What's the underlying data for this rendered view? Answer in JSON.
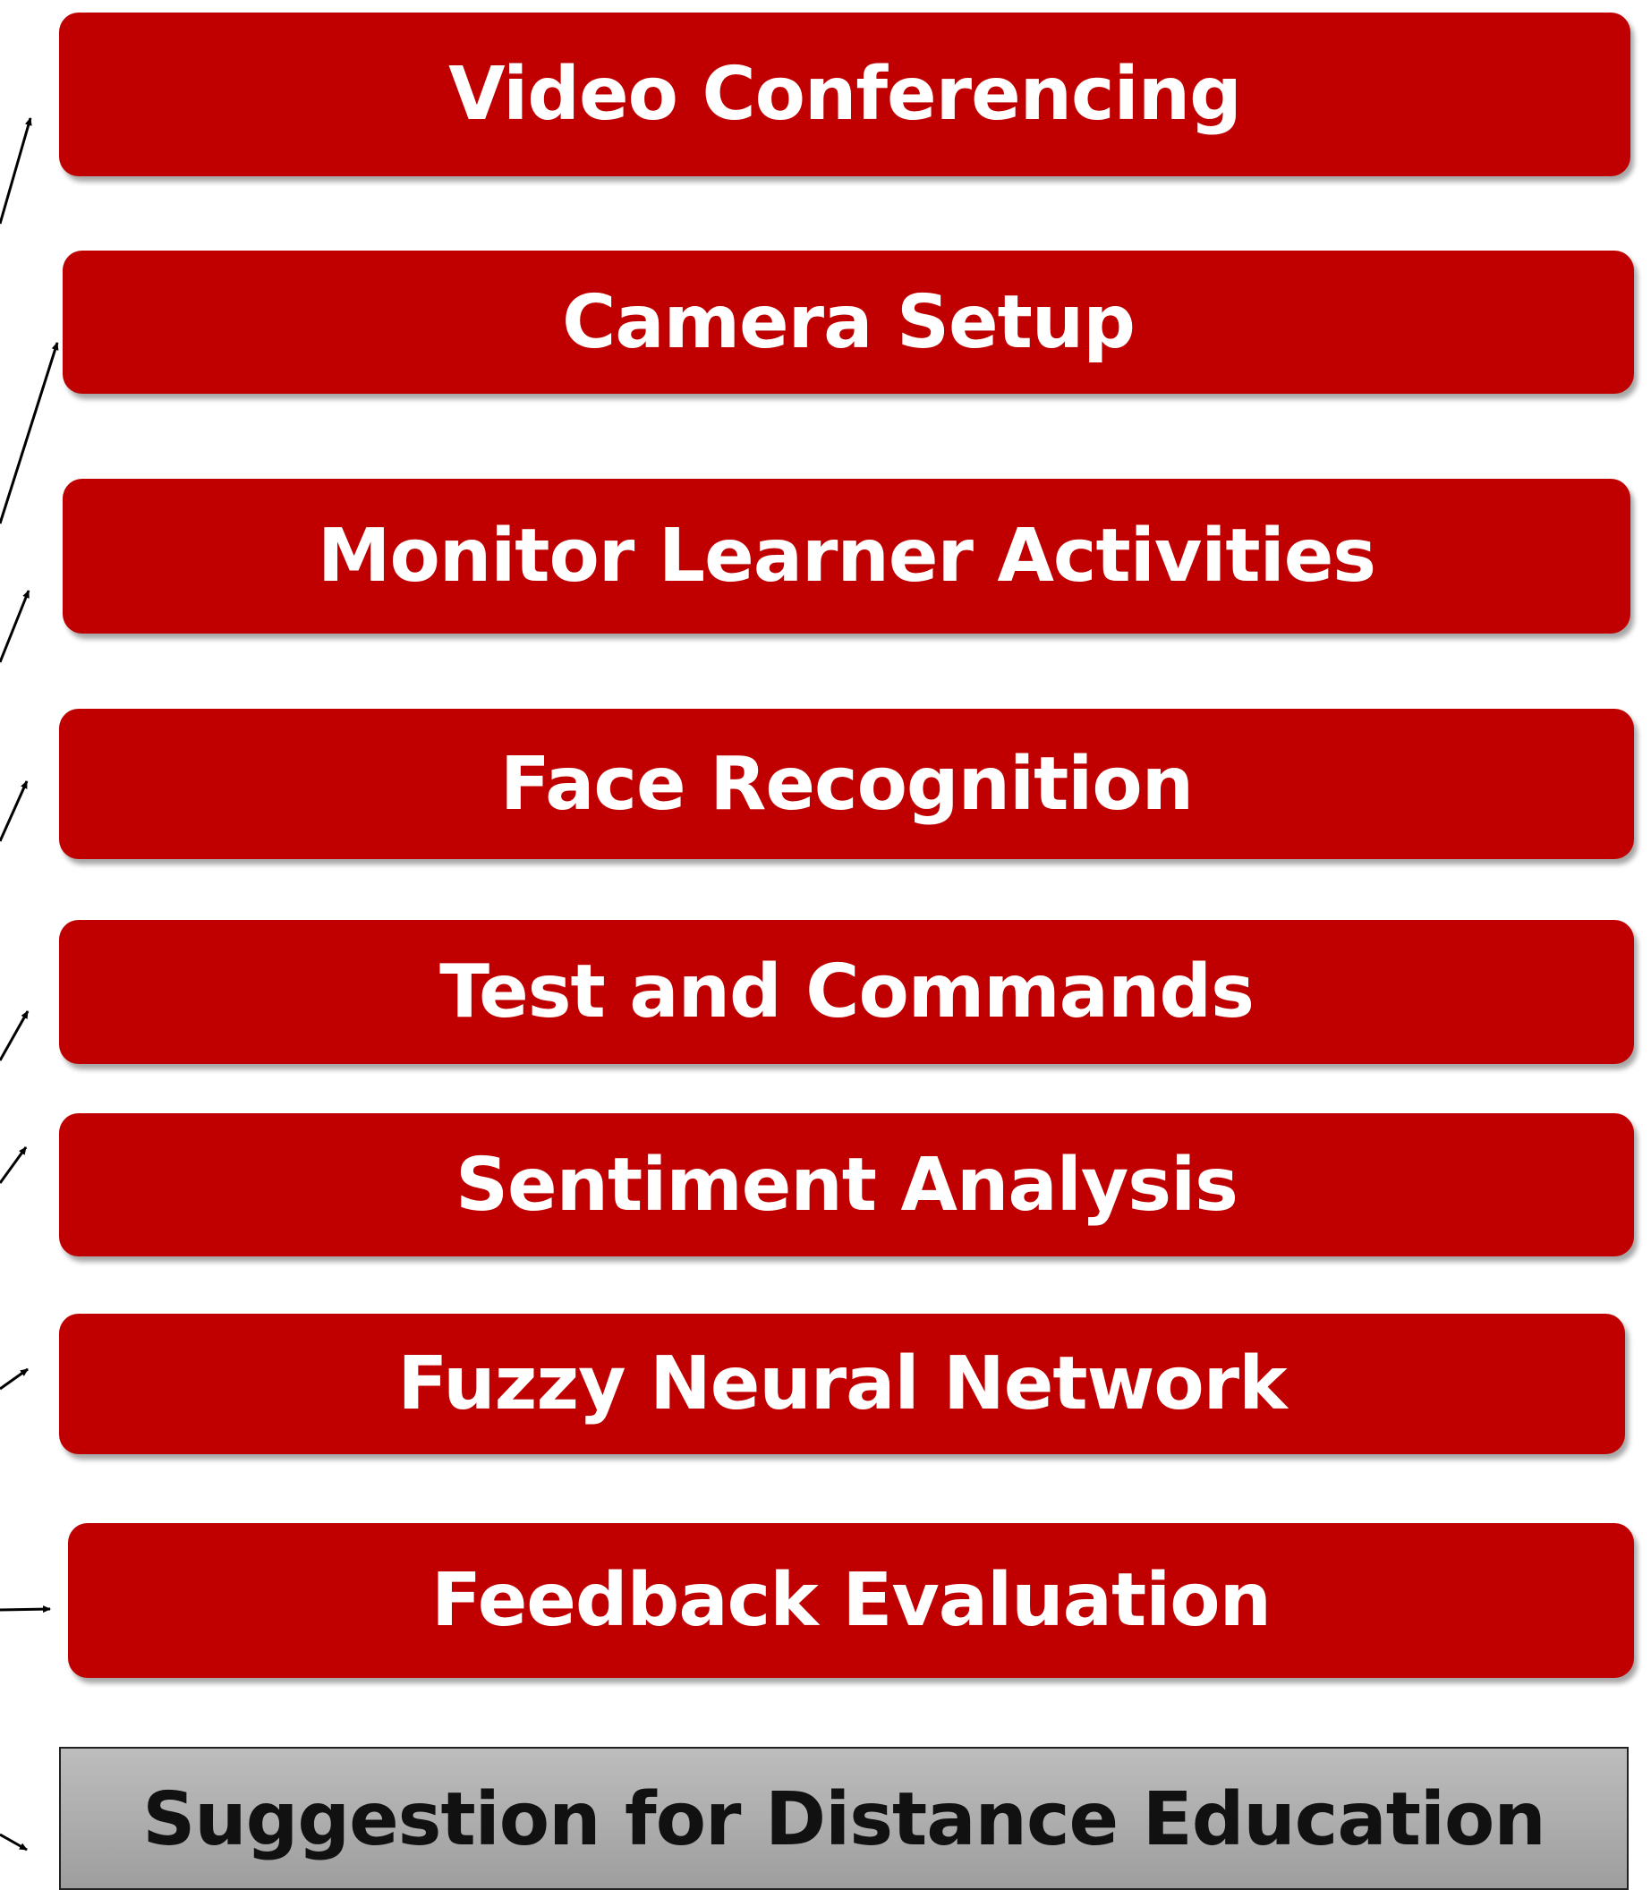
{
  "steps": [
    {
      "id": "video",
      "label": "Video Conferencing"
    },
    {
      "id": "camera",
      "label": "Camera Setup"
    },
    {
      "id": "monitor",
      "label": "Monitor Learner Activities"
    },
    {
      "id": "face",
      "label": "Face Recognition"
    },
    {
      "id": "test",
      "label": "Test and Commands"
    },
    {
      "id": "sentiment",
      "label": "Sentiment Analysis"
    },
    {
      "id": "fuzzy",
      "label": "Fuzzy Neural Network"
    },
    {
      "id": "feedback",
      "label": "Feedback Evaluation"
    }
  ],
  "outcome": {
    "label": "Suggestion for Distance Education"
  },
  "colors": {
    "step_fill": "#c00000",
    "step_text": "#ffffff",
    "outcome_fill": "#a6a6a6",
    "outcome_text": "#111111",
    "arrow": "#000000"
  }
}
